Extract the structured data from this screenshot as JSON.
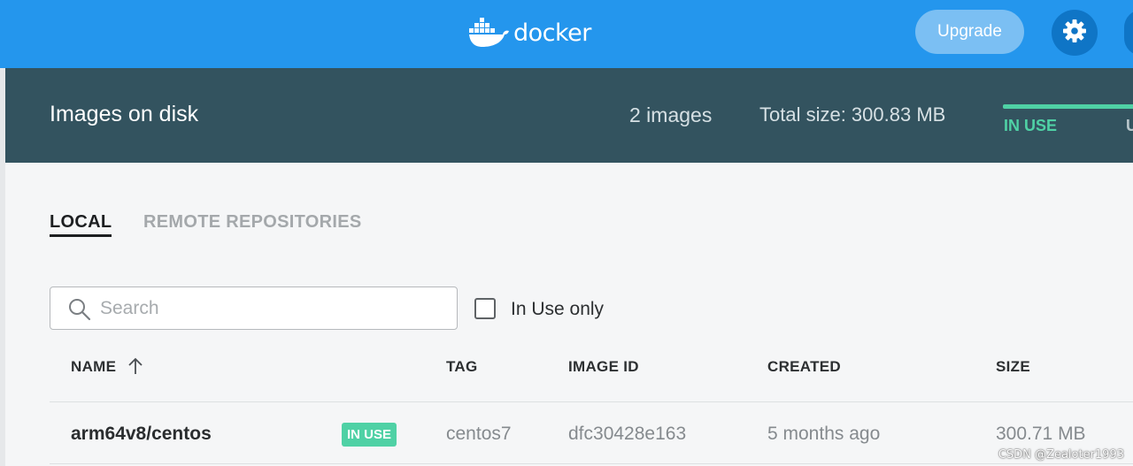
{
  "topbar": {
    "logo_text": "docker",
    "upgrade_label": "Upgrade",
    "brand_color": "#2496ed"
  },
  "disk": {
    "title": "Images on disk",
    "count": "2 images",
    "total_size": "Total size: 300.83 MB",
    "in_use_label": "IN USE",
    "unused_label_partial": "U"
  },
  "tabs": {
    "local": "LOCAL",
    "remote": "REMOTE REPOSITORIES"
  },
  "filters": {
    "search_placeholder": "Search",
    "in_use_only_label": "In Use only"
  },
  "table": {
    "columns": [
      "NAME",
      "TAG",
      "IMAGE ID",
      "CREATED",
      "SIZE"
    ],
    "rows": [
      {
        "name": "arm64v8/centos",
        "badge": "IN USE",
        "tag": "centos7",
        "image_id": "dfc30428e163",
        "created": "5 months ago",
        "size": "300.71 MB"
      }
    ]
  },
  "watermark": "CSDN @Zealoter1993"
}
